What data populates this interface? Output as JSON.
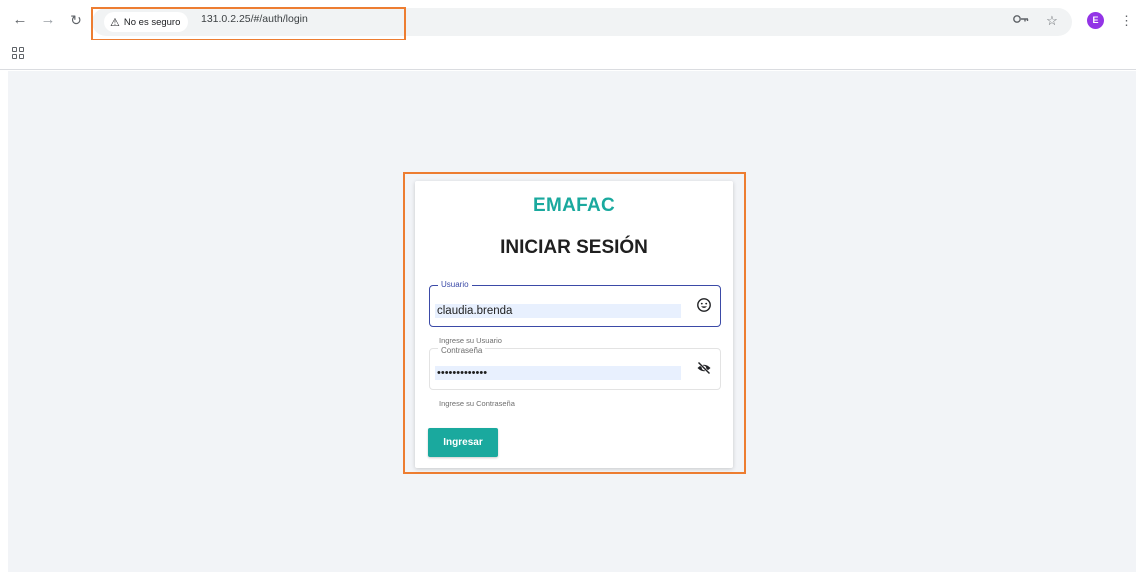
{
  "browser": {
    "security_label": "No es seguro",
    "url": "131.0.2.25/#/auth/login",
    "profile_initial": "E"
  },
  "login": {
    "brand": "EMAFAC",
    "title": "INICIAR SESIÓN",
    "username": {
      "label": "Usuario",
      "value": "claudia.brenda",
      "helper": "Ingrese su Usuario"
    },
    "password": {
      "label": "Contraseña",
      "value": "•••••••••••••",
      "helper": "Ingrese su Contraseña"
    },
    "submit_label": "Ingresar"
  },
  "colors": {
    "brand": "#1aa99e",
    "focus_border": "#3b4aa7",
    "highlight": "#ed7d31"
  },
  "icons": [
    "back-icon",
    "forward-icon",
    "reload-icon",
    "warning-icon",
    "key-icon",
    "star-icon",
    "menu-icon",
    "apps-icon",
    "emoji-icon",
    "eye-off-icon"
  ]
}
